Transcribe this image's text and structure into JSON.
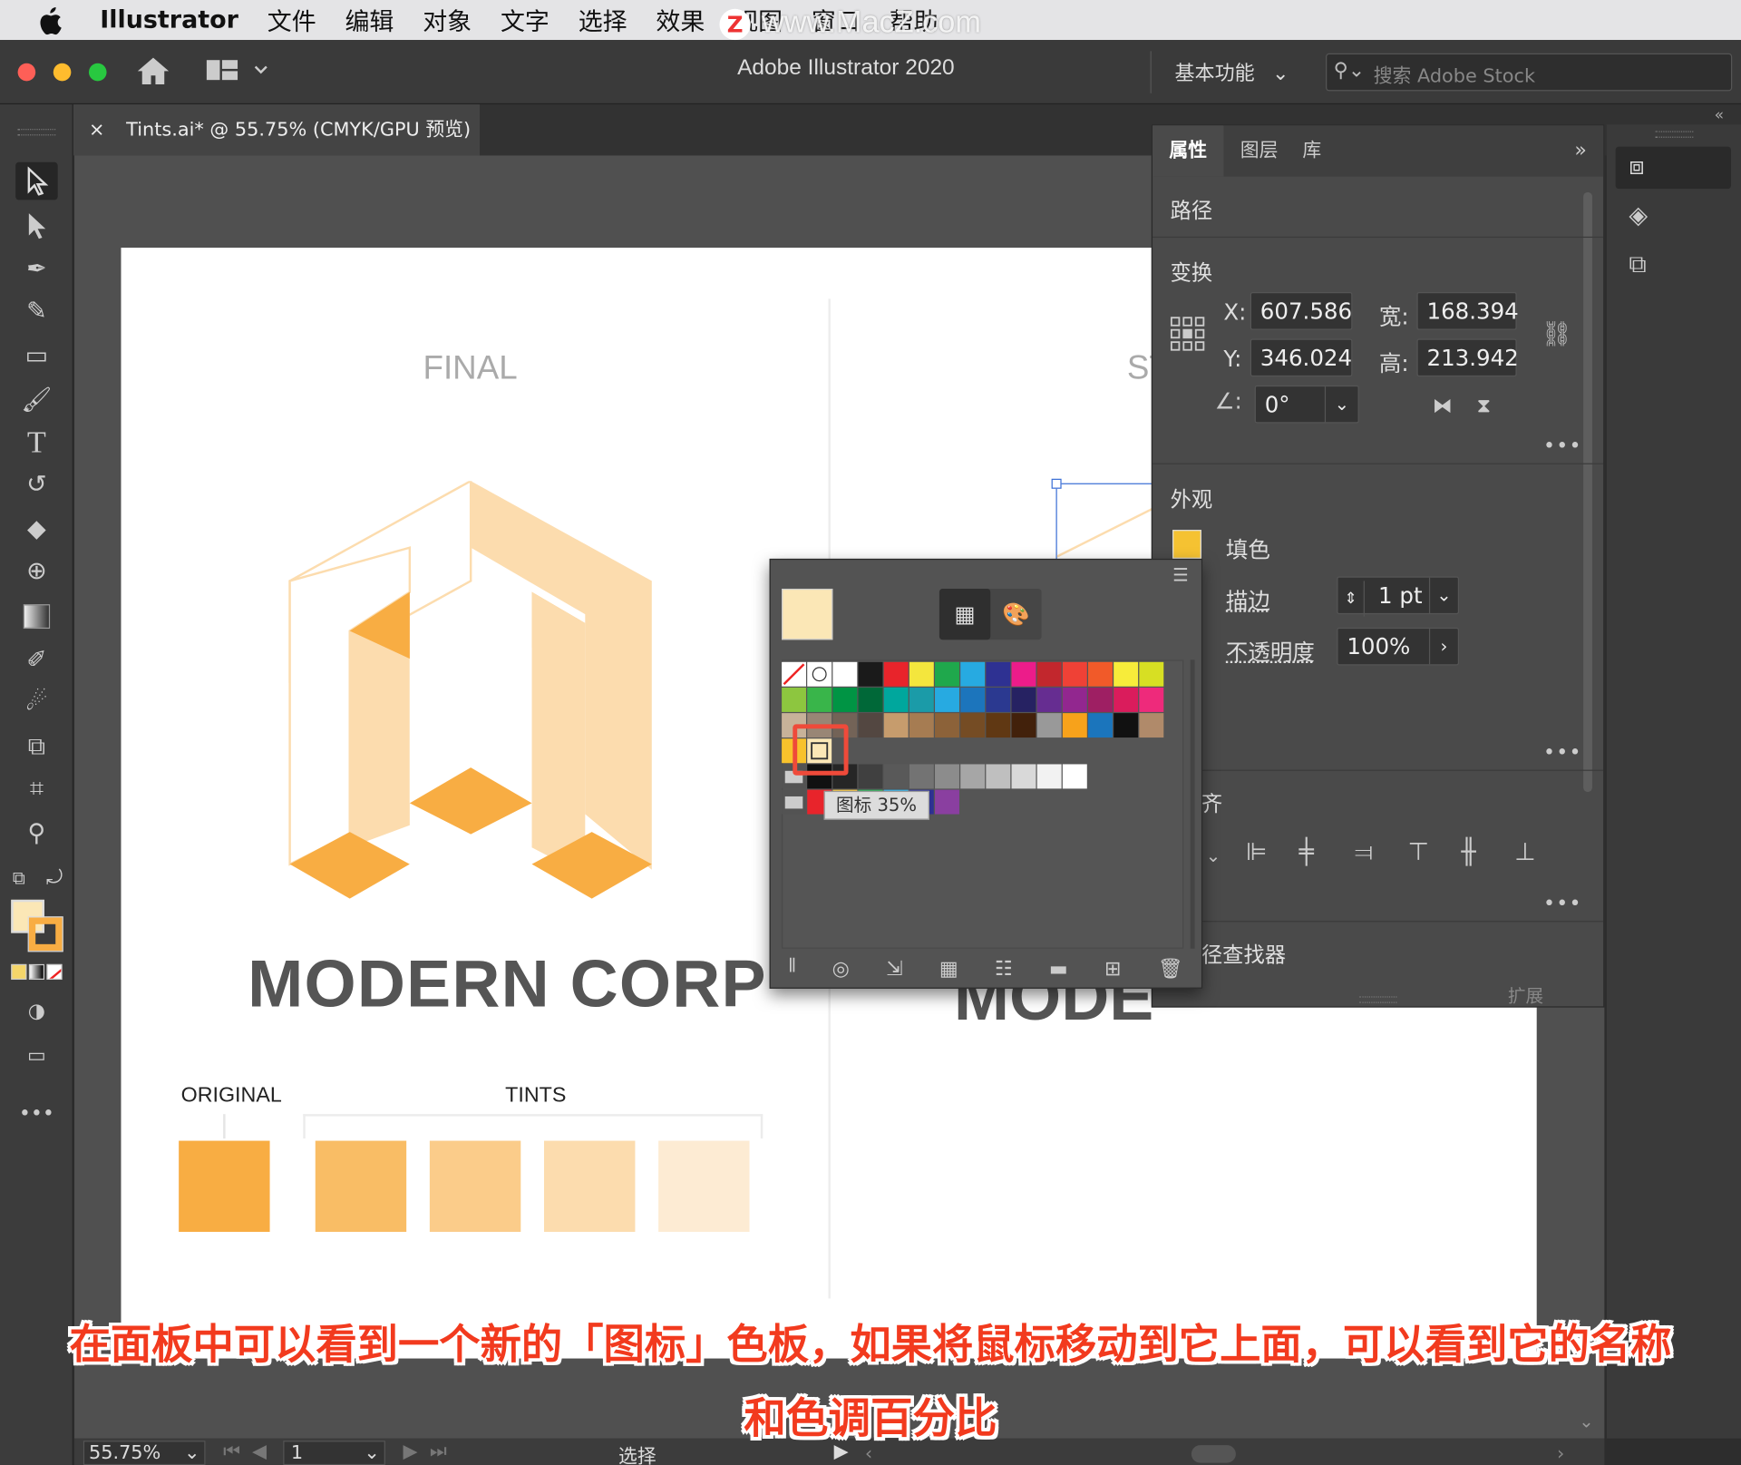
{
  "menubar": {
    "apple_icon": "",
    "app_name": "Illustrator",
    "items": [
      "文件",
      "编辑",
      "对象",
      "文字",
      "选择",
      "效果",
      "视图",
      "窗口",
      "帮助"
    ],
    "watermark": "www.MacZ.com"
  },
  "appbar": {
    "title": "Adobe Illustrator 2020",
    "workspace": "基本功能",
    "search_placeholder": "搜索 Adobe Stock"
  },
  "document_tab": {
    "close": "×",
    "label": "Tints.ai* @ 55.75% (CMYK/GPU 预览)"
  },
  "artboard": {
    "final_label": "FINAL",
    "second_label_partial": "ST",
    "logo_text": "MODERN CORP",
    "logo_text_partial": "MODE",
    "original_label": "ORIGINAL",
    "tints_label": "TINTS",
    "colors": {
      "original": "#f8ad43",
      "tint1": "#f9bd65",
      "tint2": "#fbcc8a",
      "tint3": "#fcdcae",
      "tint4": "#fdebd3"
    }
  },
  "properties_panel": {
    "tabs": [
      "属性",
      "图层",
      "库"
    ],
    "section_path": "路径",
    "section_transform": "变换",
    "x_label": "X:",
    "x_value": "607.586",
    "y_label": "Y:",
    "y_value": "346.024",
    "w_label": "宽:",
    "w_value": "168.394",
    "h_label": "高:",
    "h_value": "213.942",
    "angle_value": "0°",
    "section_appearance": "外观",
    "fill_label": "填色",
    "stroke_label": "描边",
    "stroke_value": "1 pt",
    "opacity_label": "不透明度",
    "opacity_value": "100%",
    "align_partial": "齐",
    "pathfinder_partial": "径查找器",
    "expand_partial": "扩展",
    "more": "•••"
  },
  "swatches_popup": {
    "tooltip": "图标 35%",
    "selected_color": "#fbe7b6"
  },
  "status_bar": {
    "zoom": "55.75%",
    "page": "1",
    "tool": "选择"
  },
  "caption": {
    "line1": "在面板中可以看到一个新的「图标」色板，如果将鼠标移动到它上面，可以看到它的名称",
    "line2": "和色调百分比"
  }
}
